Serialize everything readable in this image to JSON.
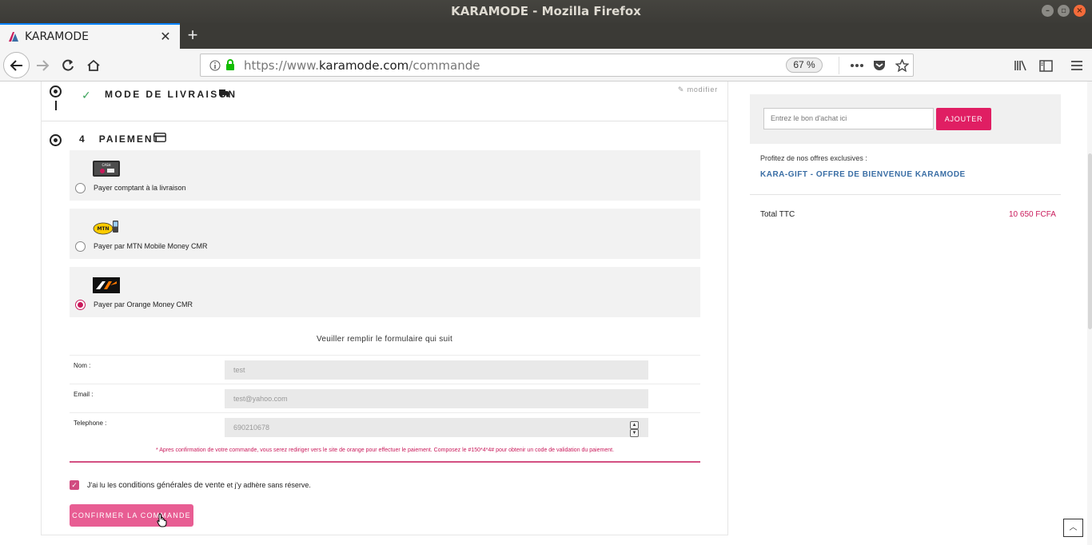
{
  "window": {
    "title": "KARAMODE - Mozilla Firefox"
  },
  "tab": {
    "title": "KARAMODE",
    "new_tab": "+"
  },
  "urlbar": {
    "scheme": "https://www.",
    "host": "karamode.com",
    "path": "/commande",
    "zoom": "67 %"
  },
  "checkout": {
    "livraison": {
      "title": "MODE DE LIVRAISON",
      "edit_label": "modifier"
    },
    "paiement": {
      "step_number": "4",
      "title": "PAIEMENT",
      "options": [
        {
          "label": "Payer comptant à la livraison",
          "logo": "cash-icon",
          "selected": false
        },
        {
          "label": "Payer par MTN Mobile Money CMR",
          "logo": "mtn-icon",
          "selected": false
        },
        {
          "label": "Payer par Orange Money CMR",
          "logo": "orange-money-icon",
          "selected": true
        }
      ]
    },
    "form": {
      "intro": "Veuiller remplir le formulaire qui suit",
      "fields": {
        "nom": {
          "label": "Nom :",
          "value": "test"
        },
        "email": {
          "label": "Email :",
          "value": "test@yahoo.com"
        },
        "telephone": {
          "label": "Telephone :",
          "value": "690210678"
        }
      },
      "note": "* Apres confirmation de votre commande, vous serez rediriger vers le site de orange pour effectuer le paiement. Composez le #150*4*4# pour obtenir un code de validation du paiement."
    },
    "terms": {
      "prefix": "J'ai lu les",
      "link": "conditions générales de vente",
      "suffix": "et j'y adhère sans réserve.",
      "checked": true
    },
    "confirm_label": "CONFIRMER LA COMMANDE"
  },
  "sidebar": {
    "voucher_placeholder": "Entrez le bon d'achat ici",
    "voucher_button": "AJOUTER",
    "offers_title": "Profitez de nos offres exclusives :",
    "offer_link": "KARA-GIFT - OFFRE DE BIENVENUE KARAMODE",
    "total_label": "Total TTC",
    "total_value": "10 650 FCFA"
  },
  "colors": {
    "accent": "#e01e63",
    "confirm_button": "#e85d93",
    "link": "#3a6ea5"
  }
}
